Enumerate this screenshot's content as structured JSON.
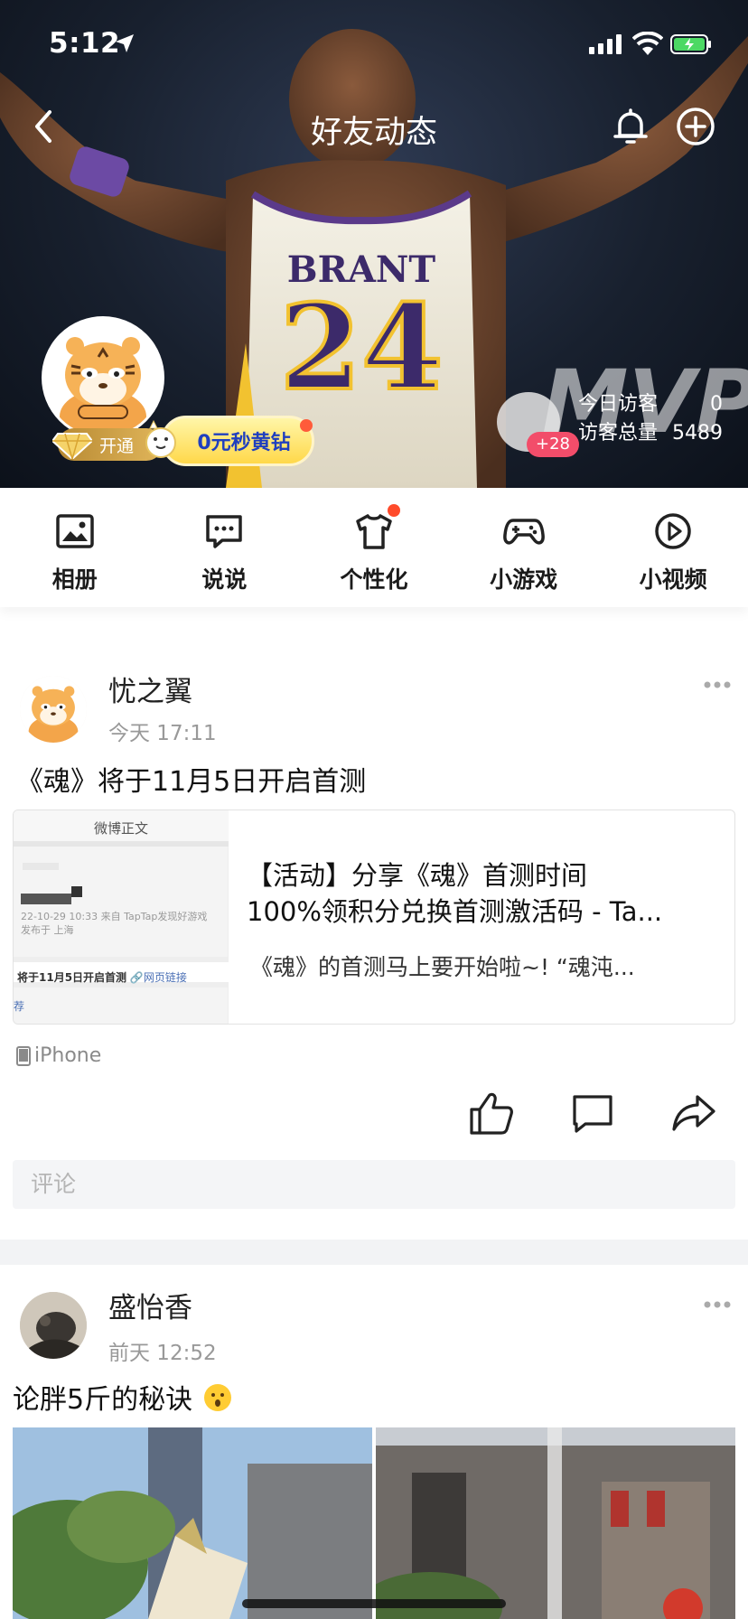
{
  "status_bar": {
    "time": "5:12"
  },
  "nav": {
    "title": "好友动态"
  },
  "cover": {
    "jersey_name": "BRANT",
    "jersey_number": "24",
    "mvp_text": "MVP",
    "vip_label": "开通",
    "promo_label": "0元秒黄钻",
    "visitors": {
      "new_badge": "+28",
      "today_label": "今日访客",
      "today_value": "0",
      "total_label": "访客总量",
      "total_value": "5489"
    }
  },
  "features": [
    {
      "label": "相册",
      "icon": "photo-album-icon"
    },
    {
      "label": "说说",
      "icon": "message-bubble-icon"
    },
    {
      "label": "个性化",
      "icon": "tshirt-icon"
    },
    {
      "label": "小游戏",
      "icon": "gamepad-icon"
    },
    {
      "label": "小视频",
      "icon": "play-circle-icon"
    }
  ],
  "posts": [
    {
      "author": "忧之翼",
      "time": "今天 17:11",
      "text": "《魂》将于11月5日开启首测",
      "share": {
        "thumb_header": "微博正文",
        "thumb_meta1": "22-10-29 10:33  来自 TapTap发现好游戏",
        "thumb_meta2": "发布于 上海",
        "thumb_bar_text": "将于11月5日开启首测",
        "thumb_bar_link": "网页链接",
        "thumb_foot": "荐",
        "title_line1": "【活动】分享《魂》首测时间",
        "title_line2": "100%领积分兑换首测激活码 - Ta...",
        "desc": "《魂》的首测马上要开始啦~! “魂沌..."
      },
      "device": "iPhone",
      "comment_placeholder": "评论"
    },
    {
      "author": "盛怡香",
      "time": "前天 12:52",
      "text": "论胖5斤的秘诀"
    }
  ],
  "colors": {
    "accent_red": "#ff4b2b",
    "promo_text": "#1f3fbf",
    "badge_pink": "#f24d6a",
    "muted_text": "#999999"
  }
}
